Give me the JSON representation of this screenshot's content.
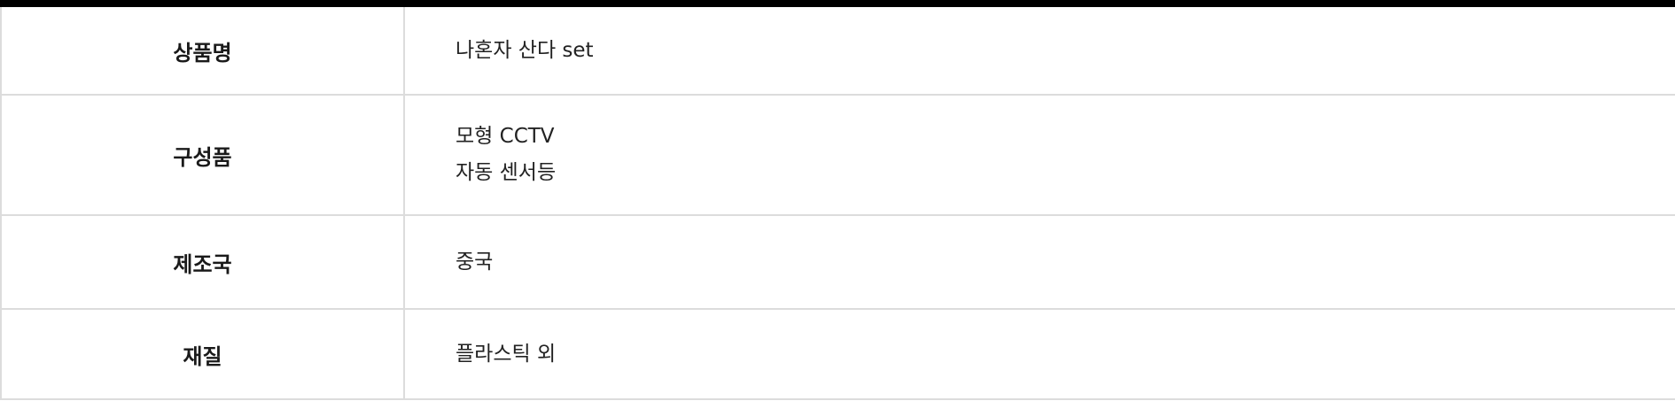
{
  "rows": [
    {
      "label": "상품명",
      "values": [
        "나혼자 산다 set"
      ]
    },
    {
      "label": "구성품",
      "values": [
        "모형 CCTV",
        "자동 센서등"
      ]
    },
    {
      "label": "제조국",
      "values": [
        "중국"
      ]
    },
    {
      "label": "재질",
      "values": [
        "플라스틱 외"
      ]
    }
  ]
}
